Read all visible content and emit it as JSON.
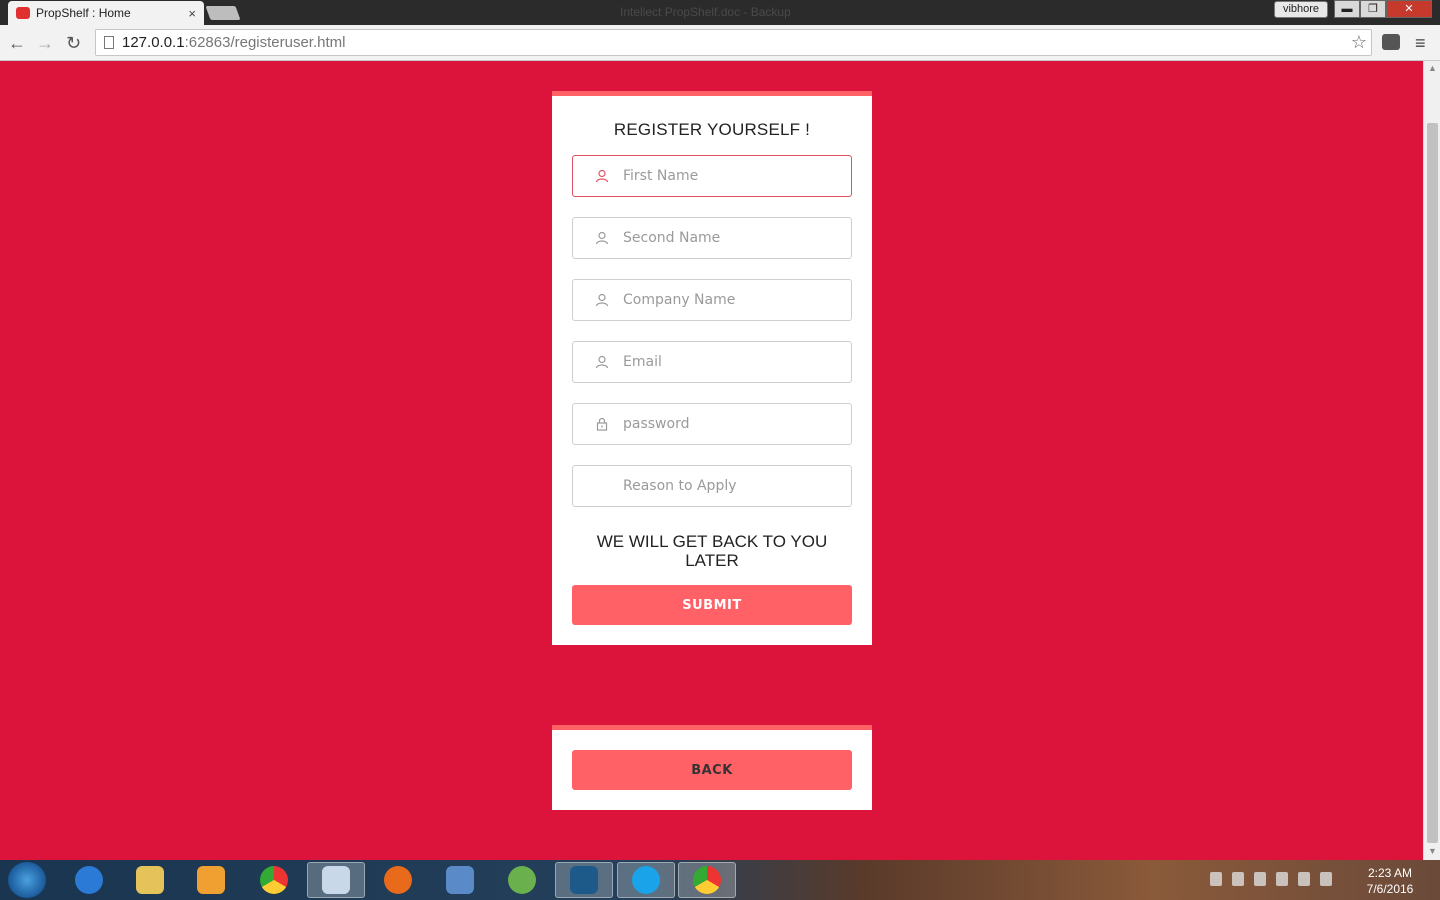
{
  "browser": {
    "tab_title": "PropShelf : Home",
    "tab_close": "×",
    "window_title": "Intellect PropShelf.doc - Backup",
    "user": "vibhore",
    "window_buttons": {
      "minimize": "▬",
      "maximize": "❐",
      "close": "✕"
    },
    "url_host": "127.0.0.1",
    "url_rest": ":62863/registeruser.html",
    "back_glyph": "←",
    "forward_glyph": "→",
    "reload_glyph": "↻",
    "star_glyph": "☆",
    "menu_glyph": "≡"
  },
  "register": {
    "title": "REGISTER YOURSELF !",
    "fields": {
      "first_name": "First Name",
      "second_name": "Second Name",
      "company_name": "Company Name",
      "email": "Email",
      "password": "password",
      "reason": "Reason to Apply"
    },
    "notice": "WE WILL GET BACK TO YOU LATER",
    "submit_label": "SUBMIT"
  },
  "back": {
    "label": "BACK"
  },
  "taskbar": {
    "apps": [
      "internet-explorer",
      "file-explorer",
      "media-player",
      "chrome",
      "paint",
      "firefox",
      "control-panel",
      "android-studio",
      "brackets",
      "skype",
      "chrome-active"
    ],
    "clock_time": "2:23 AM",
    "clock_date": "7/6/2016"
  },
  "colors": {
    "page_bg": "#dc143c",
    "accent": "#ff6166",
    "card_bg": "#ffffff"
  }
}
